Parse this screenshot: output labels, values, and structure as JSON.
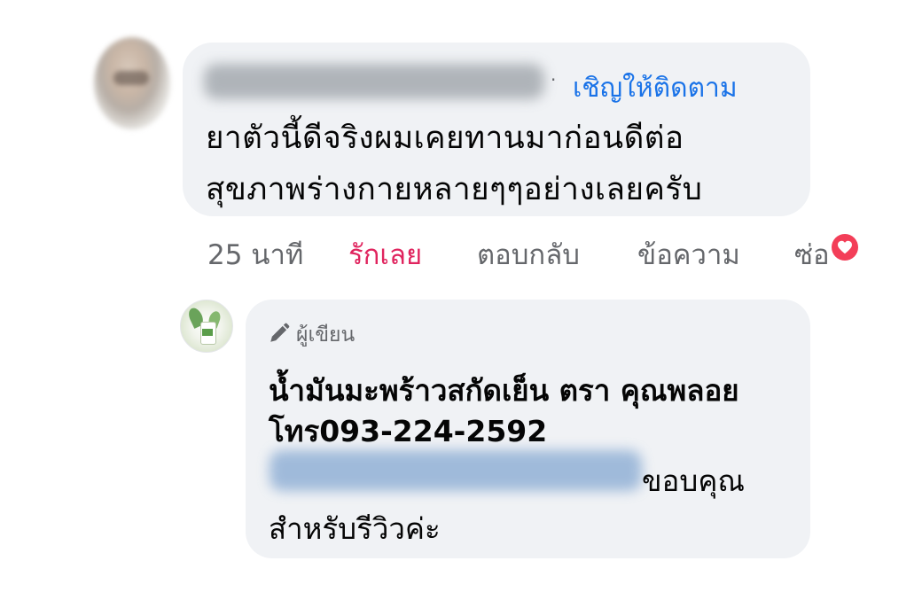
{
  "comment": {
    "follow_label": "เชิญให้ติดตาม",
    "separator": "·",
    "text_line1": "ยาตัวนี้ดีจริงผมเคยทานมาก่อนดีต่อ",
    "text_line2": "สุขภาพร่างกายหลายๆๆอย่างเลยครับ",
    "name_blurred": true
  },
  "actions": {
    "time": "25 นาที",
    "like": "รักเลย",
    "reply": "ตอบกลับ",
    "message": "ข้อความ",
    "more": "ซ่อ",
    "reaction_icon": "heart-icon",
    "like_color": "#e0245e",
    "reaction_color": "#f33e58"
  },
  "reply": {
    "author_badge_icon": "pen-icon",
    "author_badge": "ผู้เขียน",
    "line1": "น้ำมันมะพร้าวสกัดเย็น ตรา คุณพลอย",
    "line2": "โทร093-224-2592",
    "line3": "ขอบคุณ",
    "line4": "สำหรับรีวิวค่ะ",
    "mention_blurred": true
  },
  "colors": {
    "bubble": "#f0f2f5",
    "link": "#1a73e8",
    "muted": "#65676b",
    "text": "#050505"
  }
}
